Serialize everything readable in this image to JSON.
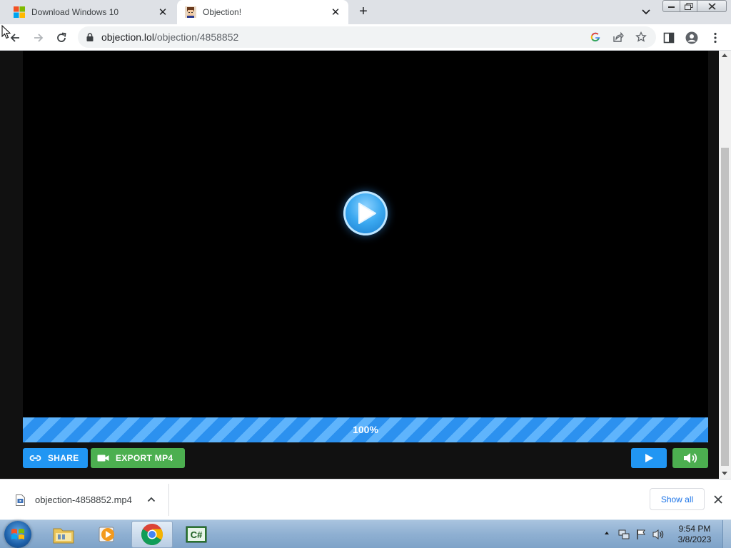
{
  "browser": {
    "tabs": [
      {
        "title": "Download Windows 10",
        "active": false,
        "favicon": "windows-logo-icon"
      },
      {
        "title": "Objection!",
        "active": true,
        "favicon": "objection-avatar-icon"
      }
    ],
    "new_tab_icon": "plus-icon",
    "tab_search_icon": "chevron-down-icon",
    "address": {
      "host": "objection.lol",
      "path": "/objection/4858852",
      "secure_icon": "lock-icon"
    },
    "toolbar_icons": [
      "google-lens-icon",
      "share-icon",
      "bookmark-star-icon",
      "side-panel-icon",
      "profile-icon",
      "more-menu-icon"
    ]
  },
  "player": {
    "progress_label": "100%",
    "progress_value": 1.0,
    "share_label": "SHARE",
    "export_label": "EXPORT MP4",
    "colors": {
      "blue": "#2196f3",
      "green": "#4caf50",
      "video_bg": "#000000",
      "page_bg": "#111111"
    }
  },
  "downloads": {
    "file_name": "objection-4858852.mp4",
    "show_all_label": "Show all"
  },
  "taskbar": {
    "apps": [
      "file-explorer-icon",
      "media-player-icon",
      "chrome-icon",
      "csharp-icon"
    ],
    "active_app": "chrome-icon",
    "clock_time": "9:54 PM",
    "clock_date": "3/8/2023"
  }
}
